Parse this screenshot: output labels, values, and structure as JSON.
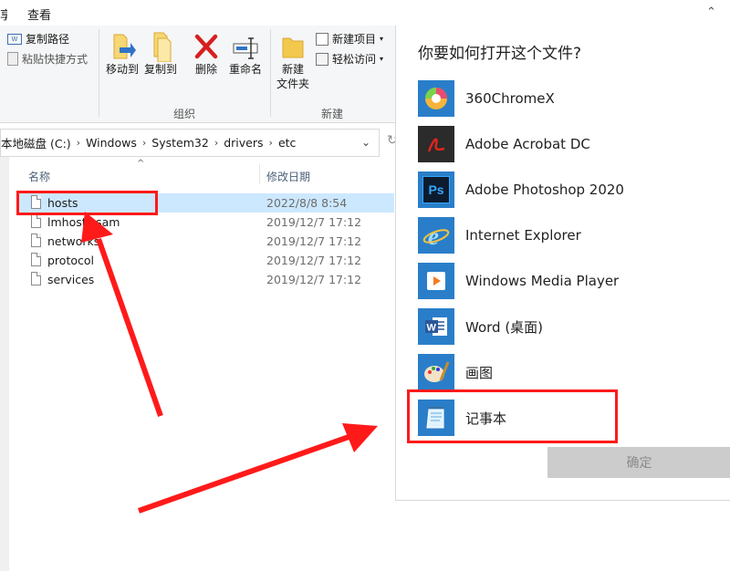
{
  "ribbon": {
    "view_tab": "查看",
    "left_clip_tab": "享",
    "clipboard": {
      "copy_path": "复制路径",
      "paste_shortcut": "粘贴快捷方式"
    },
    "organize": {
      "move_to": "移动到",
      "copy_to": "复制到",
      "delete": "删除",
      "rename": "重命名",
      "group_label": "组织"
    },
    "new": {
      "new_folder": "新建\n文件夹",
      "new_folder_line1": "新建",
      "new_folder_line2": "文件夹",
      "new_item": "新建项目",
      "easy_access": "轻松访问",
      "group_label": "新建"
    }
  },
  "address_bar": {
    "crumbs": [
      "本地磁盘 (C:)",
      "Windows",
      "System32",
      "drivers",
      "etc"
    ]
  },
  "file_list": {
    "columns": {
      "name": "名称",
      "modified": "修改日期"
    },
    "rows": [
      {
        "name": "hosts",
        "date": "2022/8/8 8:54"
      },
      {
        "name": "lmhosts.sam",
        "date": "2019/12/7 17:12"
      },
      {
        "name": "networks",
        "date": "2019/12/7 17:12"
      },
      {
        "name": "protocol",
        "date": "2019/12/7 17:12"
      },
      {
        "name": "services",
        "date": "2019/12/7 17:12"
      }
    ]
  },
  "dialog": {
    "title": "你要如何打开这个文件?",
    "apps": [
      {
        "label": "360ChromeX",
        "icon": "chrome360-icon"
      },
      {
        "label": "Adobe Acrobat DC",
        "icon": "acrobat-icon"
      },
      {
        "label": "Adobe Photoshop 2020",
        "icon": "photoshop-icon"
      },
      {
        "label": "Internet Explorer",
        "icon": "internet-explorer-icon"
      },
      {
        "label": "Windows Media Player",
        "icon": "media-player-icon"
      },
      {
        "label": "Word (桌面)",
        "icon": "word-icon"
      },
      {
        "label": "画图",
        "icon": "paint-icon"
      },
      {
        "label": "记事本",
        "icon": "notepad-icon"
      }
    ],
    "ok_button": "确定"
  },
  "colors": {
    "annotation_red": "#ff1a1a",
    "selection_gray": "#cce8ff",
    "button_disabled": "#cccccc"
  }
}
